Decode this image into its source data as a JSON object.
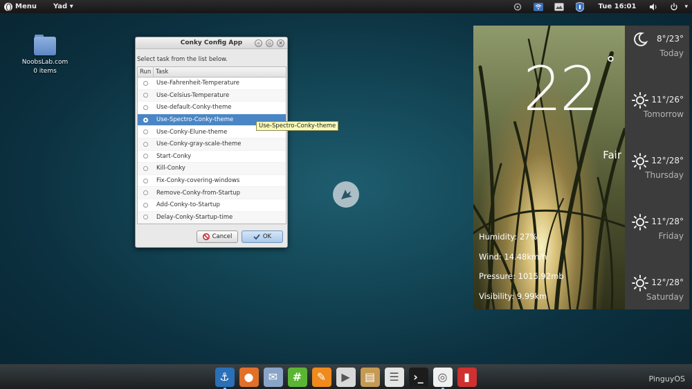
{
  "top_panel": {
    "menu_label": "Menu",
    "yad_label": "Yad ▾",
    "clock": "Tue 16:01"
  },
  "desktop": {
    "folder_name": "NoobsLab.com",
    "folder_count": "0 items"
  },
  "dialog": {
    "title": "Conky Config App",
    "instruction": "Select task from the list below.",
    "col_run": "Run",
    "col_task": "Task",
    "tasks": [
      "Use-Fahrenheit-Temperature",
      "Use-Celsius-Temperature",
      "Use-default-Conky-theme",
      "Use-Spectro-Conky-theme",
      "Use-Conky-Elune-theme",
      "Use-Conky-gray-scale-theme",
      "Start-Conky",
      "Kill-Conky",
      "Fix-Conky-covering-windows",
      "Remove-Conky-from-Startup",
      "Add-Conky-to-Startup",
      "Delay-Conky-Startup-time"
    ],
    "selected_index": 3,
    "tooltip": "Use-Spectro-Conky-theme",
    "cancel_label": "Cancel",
    "ok_label": "OK"
  },
  "weather": {
    "current_temp": "22",
    "degree": "°",
    "condition": "Fair",
    "humidity": "Humidity:  27%",
    "wind": "Wind:  14.48km/h",
    "pressure": "Pressure:  1015.92mb",
    "visibility": "Visibility:  9.99km",
    "forecast": [
      {
        "temp": "8°/23°",
        "day": "Today",
        "icon": "moon-icon"
      },
      {
        "temp": "11°/26°",
        "day": "Tomorrow",
        "icon": "sun-icon"
      },
      {
        "temp": "12°/28°",
        "day": "Thursday",
        "icon": "sun-icon"
      },
      {
        "temp": "11°/28°",
        "day": "Friday",
        "icon": "sun-icon"
      },
      {
        "temp": "12°/28°",
        "day": "Saturday",
        "icon": "sun-icon"
      }
    ]
  },
  "dock": {
    "label": "PinguyOS",
    "apps": [
      "anchor-icon",
      "firefox-icon",
      "mail-stamp-icon",
      "chat-icon",
      "pen-icon",
      "video-editor-icon",
      "archive-icon",
      "mixer-icon",
      "terminal-icon",
      "spiral-icon",
      "bookmark-icon"
    ]
  },
  "colors": {
    "selection": "#4a86c5",
    "tooltip_bg": "#fafab8",
    "weather_side": "#3c3c3c"
  }
}
